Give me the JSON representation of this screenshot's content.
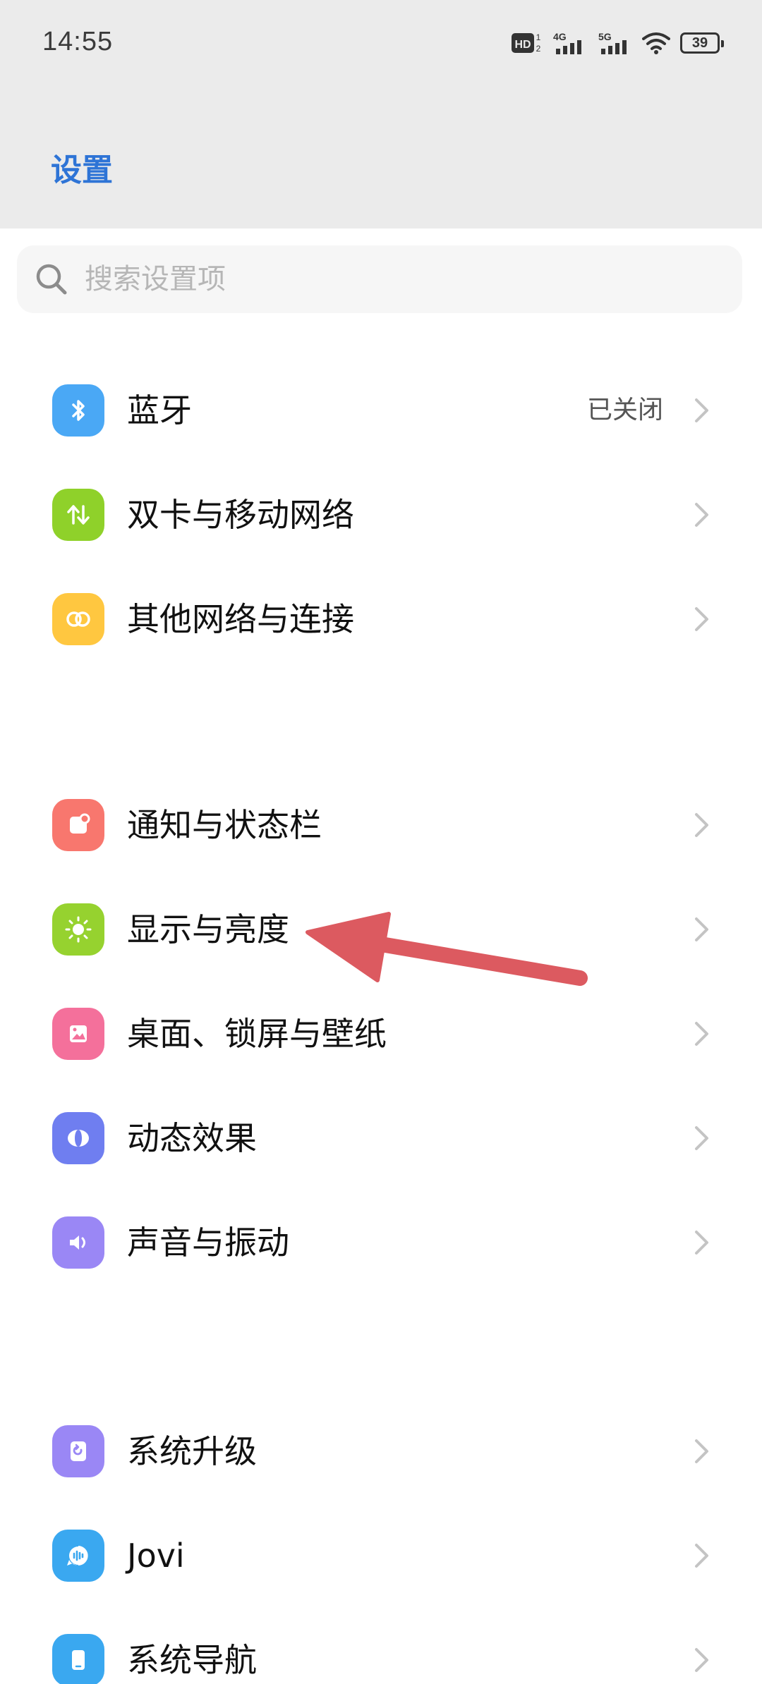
{
  "status_bar": {
    "time": "14:55",
    "hd_label": "HD",
    "sim1_label": "4G",
    "sim2_label": "5G",
    "battery_level": "39"
  },
  "header": {
    "title": "设置"
  },
  "search": {
    "placeholder": "搜索设置项"
  },
  "items": [
    {
      "label": "蓝牙",
      "value": "已关闭",
      "icon": "bluetooth-icon",
      "color": "#4aa8f5"
    },
    {
      "label": "双卡与移动网络",
      "icon": "data-transfer-icon",
      "color": "#8fd12a"
    },
    {
      "label": "其他网络与连接",
      "icon": "link-icon",
      "color": "#ffc740"
    },
    {
      "label": "通知与状态栏",
      "icon": "notification-icon",
      "color": "#f8776e"
    },
    {
      "label": "显示与亮度",
      "icon": "sun-icon",
      "color": "#96d22f"
    },
    {
      "label": "桌面、锁屏与壁纸",
      "icon": "image-icon",
      "color": "#f4709b"
    },
    {
      "label": "动态效果",
      "icon": "motion-icon",
      "color": "#6f7ef0"
    },
    {
      "label": "声音与振动",
      "icon": "speaker-icon",
      "color": "#9a87f5"
    },
    {
      "label": "系统升级",
      "icon": "update-icon",
      "color": "#9a87f5"
    },
    {
      "label": "Jovi",
      "icon": "jovi-icon",
      "color": "#3aa8f0"
    },
    {
      "label": "系统导航",
      "icon": "phone-icon",
      "color": "#3aa8f0"
    }
  ]
}
